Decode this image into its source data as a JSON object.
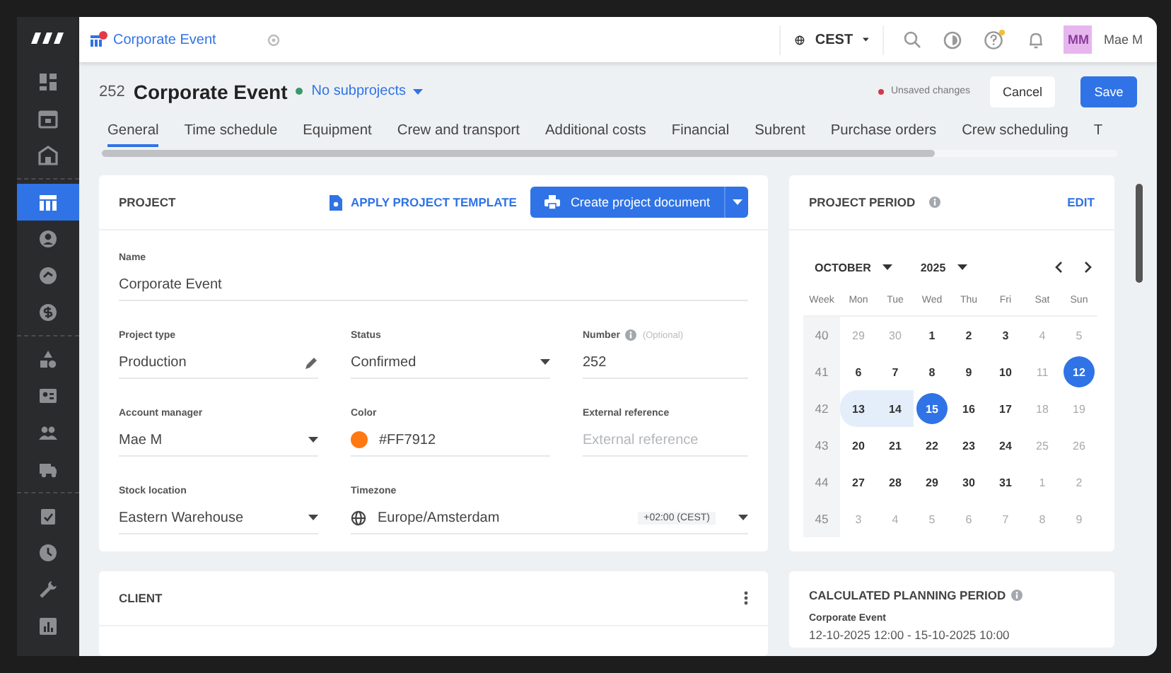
{
  "sidebar": {
    "groups": [
      {
        "items": [
          {
            "selected": false
          },
          {
            "selected": false
          },
          {
            "selected": false
          }
        ]
      },
      {
        "items": [
          {
            "selected": true
          },
          {
            "selected": false
          },
          {
            "selected": false
          },
          {
            "selected": false
          }
        ]
      },
      {
        "items": [
          {
            "selected": false
          },
          {
            "selected": false
          },
          {
            "selected": false
          },
          {
            "selected": false
          }
        ]
      },
      {
        "items": [
          {
            "selected": false
          },
          {
            "selected": false
          },
          {
            "selected": false
          },
          {
            "selected": false
          }
        ]
      }
    ]
  },
  "topbar": {
    "tab_title": "Corporate Event",
    "timezone": "CEST",
    "avatar": "MM",
    "user": "Mae M"
  },
  "header": {
    "number": "252",
    "title": "Corporate Event",
    "subprojects": "No subprojects",
    "unsaved": "Unsaved changes",
    "cancel": "Cancel",
    "save": "Save"
  },
  "tabs": [
    {
      "label": "General",
      "selected": true
    },
    {
      "label": "Time schedule",
      "selected": false
    },
    {
      "label": "Equipment",
      "selected": false
    },
    {
      "label": "Crew and transport",
      "selected": false
    },
    {
      "label": "Additional costs",
      "selected": false
    },
    {
      "label": "Financial",
      "selected": false
    },
    {
      "label": "Subrent",
      "selected": false
    },
    {
      "label": "Purchase orders",
      "selected": false
    },
    {
      "label": "Crew scheduling",
      "selected": false
    },
    {
      "label": "T",
      "selected": false
    }
  ],
  "project": {
    "title": "PROJECT",
    "apply_template": "APPLY PROJECT TEMPLATE",
    "create_document": "Create project document",
    "name": {
      "label": "Name",
      "value": "Corporate Event"
    },
    "fields": [
      {
        "kind": "edit",
        "label": "Project type",
        "value": "Production"
      },
      {
        "kind": "select",
        "label": "Status",
        "value": "Confirmed"
      },
      {
        "kind": "number",
        "label": "Number",
        "hint": "(Optional)",
        "value": "252"
      },
      {
        "kind": "select",
        "label": "Account manager",
        "value": "Mae M"
      },
      {
        "kind": "color",
        "label": "Color",
        "value": "#FF7912"
      },
      {
        "kind": "text",
        "label": "External reference",
        "placeholder": "External reference"
      },
      {
        "kind": "select",
        "label": "Stock location",
        "value": "Eastern Warehouse"
      },
      {
        "kind": "timezone",
        "label": "Timezone",
        "value": "Europe/Amsterdam",
        "offset": "+02:00 (CEST)"
      }
    ]
  },
  "client": {
    "title": "CLIENT"
  },
  "period": {
    "title": "PROJECT PERIOD",
    "edit": "EDIT",
    "month": "OCTOBER",
    "year": "2025",
    "weekdays": [
      "Week",
      "Mon",
      "Tue",
      "Wed",
      "Thu",
      "Fri",
      "Sat",
      "Sun"
    ],
    "weeks": [
      {
        "week": "40",
        "days": [
          {
            "day": "29",
            "kind": "outside"
          },
          {
            "day": "30",
            "kind": "outside"
          },
          {
            "day": "1",
            "kind": "weekday"
          },
          {
            "day": "2",
            "kind": "weekday"
          },
          {
            "day": "3",
            "kind": "weekday"
          },
          {
            "day": "4",
            "kind": "weekend"
          },
          {
            "day": "5",
            "kind": "weekend"
          }
        ]
      },
      {
        "week": "41",
        "days": [
          {
            "day": "6",
            "kind": "weekday"
          },
          {
            "day": "7",
            "kind": "weekday"
          },
          {
            "day": "8",
            "kind": "weekday"
          },
          {
            "day": "9",
            "kind": "weekday"
          },
          {
            "day": "10",
            "kind": "weekday"
          },
          {
            "day": "11",
            "kind": "weekend"
          },
          {
            "day": "12",
            "kind": "selected"
          }
        ]
      },
      {
        "week": "42",
        "days": [
          {
            "day": "13",
            "kind": "range"
          },
          {
            "day": "14",
            "kind": "range"
          },
          {
            "day": "15",
            "kind": "selected"
          },
          {
            "day": "16",
            "kind": "weekday"
          },
          {
            "day": "17",
            "kind": "weekday"
          },
          {
            "day": "18",
            "kind": "weekend"
          },
          {
            "day": "19",
            "kind": "weekend"
          }
        ]
      },
      {
        "week": "43",
        "days": [
          {
            "day": "20",
            "kind": "weekday"
          },
          {
            "day": "21",
            "kind": "weekday"
          },
          {
            "day": "22",
            "kind": "weekday"
          },
          {
            "day": "23",
            "kind": "weekday"
          },
          {
            "day": "24",
            "kind": "weekday"
          },
          {
            "day": "25",
            "kind": "weekend"
          },
          {
            "day": "26",
            "kind": "weekend"
          }
        ]
      },
      {
        "week": "44",
        "days": [
          {
            "day": "27",
            "kind": "weekday"
          },
          {
            "day": "28",
            "kind": "weekday"
          },
          {
            "day": "29",
            "kind": "weekday"
          },
          {
            "day": "30",
            "kind": "weekday"
          },
          {
            "day": "31",
            "kind": "weekday"
          },
          {
            "day": "1",
            "kind": "outside"
          },
          {
            "day": "2",
            "kind": "outside"
          }
        ]
      },
      {
        "week": "45",
        "days": [
          {
            "day": "3",
            "kind": "outside"
          },
          {
            "day": "4",
            "kind": "outside"
          },
          {
            "day": "5",
            "kind": "outside"
          },
          {
            "day": "6",
            "kind": "outside"
          },
          {
            "day": "7",
            "kind": "outside"
          },
          {
            "day": "8",
            "kind": "outside"
          },
          {
            "day": "9",
            "kind": "outside"
          }
        ]
      }
    ]
  },
  "planning": {
    "title": "CALCULATED PLANNING PERIOD",
    "label": "Corporate Event",
    "value": "12-10-2025 12:00 - 15-10-2025 10:00"
  }
}
